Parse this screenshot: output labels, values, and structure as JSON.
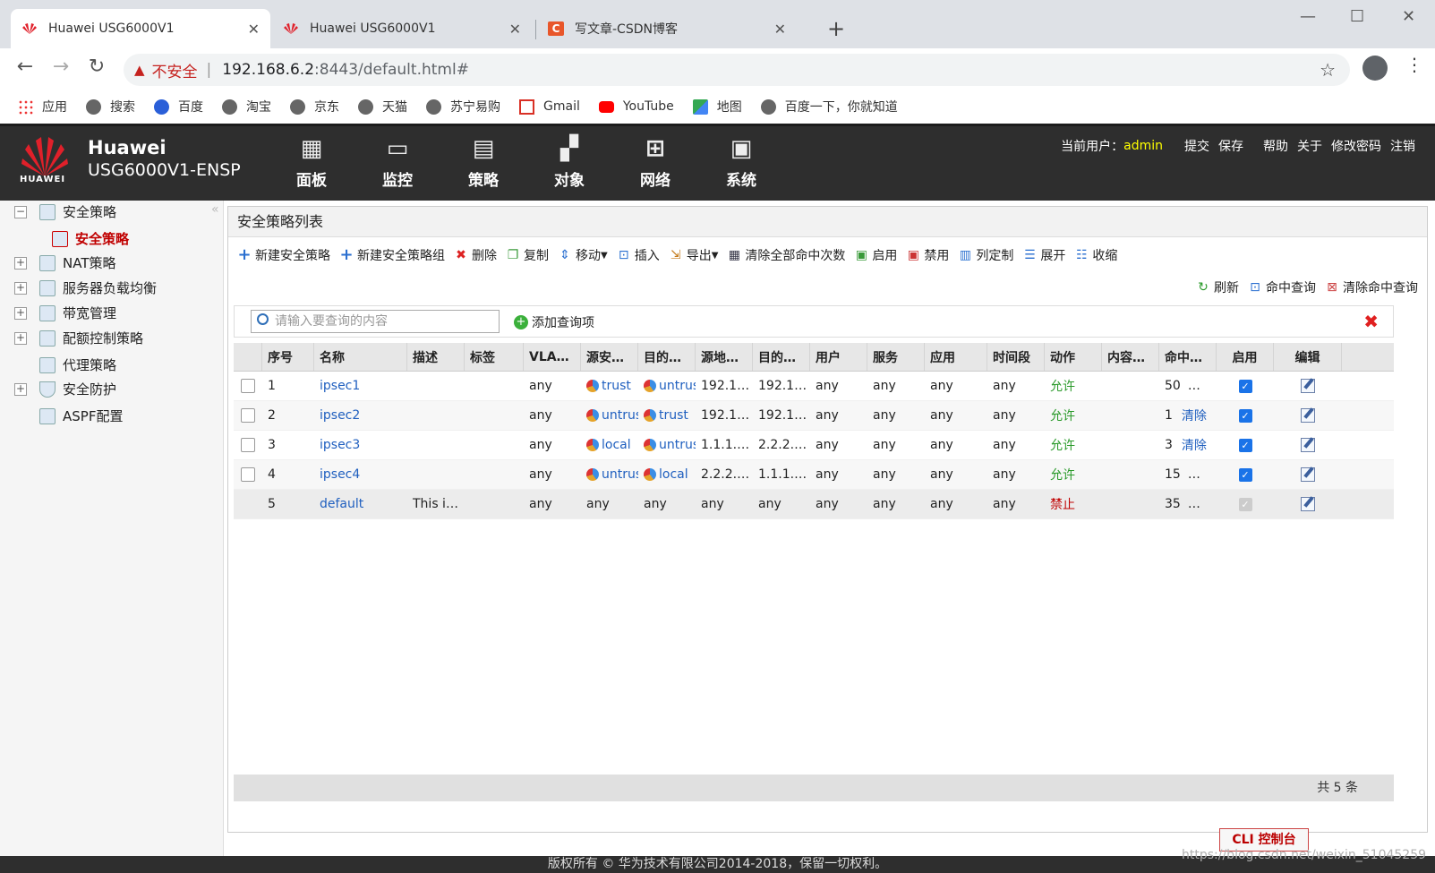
{
  "browser": {
    "tabs": [
      {
        "title": "Huawei USG6000V1",
        "active": true
      },
      {
        "title": "Huawei USG6000V1",
        "active": false
      },
      {
        "title": "写文章-CSDN博客",
        "active": false
      }
    ],
    "omnibox": {
      "security_label": "不安全",
      "host": "192.168.6.2",
      "path": ":8443/default.html#"
    },
    "bookmarks": [
      "应用",
      "搜索",
      "百度",
      "淘宝",
      "京东",
      "天猫",
      "苏宁易购",
      "Gmail",
      "YouTube",
      "地图",
      "百度一下，你就知道"
    ]
  },
  "app": {
    "brand_line1": "Huawei",
    "brand_line2": "USG6000V1-ENSP",
    "logo_text": "HUAWEI",
    "main_nav": [
      "面板",
      "监控",
      "策略",
      "对象",
      "网络",
      "系统"
    ],
    "user_label": "当前用户：",
    "user_name": "admin",
    "user_links": [
      "提交",
      "保存",
      "帮助",
      "关于",
      "修改密码",
      "注销"
    ]
  },
  "sidebar": {
    "items": [
      {
        "label": "安全策略",
        "expander": "−"
      },
      {
        "label": "安全策略",
        "selected": true
      },
      {
        "label": "NAT策略",
        "expander": "+"
      },
      {
        "label": "服务器负载均衡",
        "expander": "+"
      },
      {
        "label": "带宽管理",
        "expander": "+"
      },
      {
        "label": "配额控制策略",
        "expander": "+"
      },
      {
        "label": "代理策略",
        "expander": ""
      },
      {
        "label": "安全防护",
        "expander": "+"
      },
      {
        "label": "ASPF配置",
        "expander": ""
      }
    ]
  },
  "page": {
    "title": "安全策略列表",
    "toolbar": [
      "新建安全策略",
      "新建安全策略组",
      "删除",
      "复制",
      "移动",
      "插入",
      "导出",
      "清除全部命中次数",
      "启用",
      "禁用",
      "列定制",
      "展开",
      "收缩"
    ],
    "toolbar2": [
      "刷新",
      "命中查询",
      "清除命中查询"
    ],
    "search_placeholder": "请输入要查询的内容",
    "add_query": "添加查询项",
    "columns": [
      "序号",
      "名称",
      "描述",
      "标签",
      "VLA…",
      "源安…",
      "目的…",
      "源地…",
      "目的…",
      "用户",
      "服务",
      "应用",
      "时间段",
      "动作",
      "内容…",
      "命中…",
      "启用",
      "编辑"
    ],
    "rows": [
      {
        "no": "1",
        "name": "ipsec1",
        "desc": "",
        "tag": "",
        "vlan": "any",
        "src_zone": "trust",
        "dst_zone": "untrust",
        "src_addr": "192.1…",
        "dst_addr": "192.1…",
        "user": "any",
        "service": "any",
        "app": "any",
        "time": "any",
        "action": "允许",
        "content": "",
        "hits": "50",
        "hits_extra": "…",
        "enabled": true
      },
      {
        "no": "2",
        "name": "ipsec2",
        "desc": "",
        "tag": "",
        "vlan": "any",
        "src_zone": "untrust",
        "dst_zone": "trust",
        "src_addr": "192.1…",
        "dst_addr": "192.1…",
        "user": "any",
        "service": "any",
        "app": "any",
        "time": "any",
        "action": "允许",
        "content": "",
        "hits": "1",
        "hits_extra": "清除",
        "enabled": true
      },
      {
        "no": "3",
        "name": "ipsec3",
        "desc": "",
        "tag": "",
        "vlan": "any",
        "src_zone": "local",
        "dst_zone": "untrust",
        "src_addr": "1.1.1.…",
        "dst_addr": "2.2.2.…",
        "user": "any",
        "service": "any",
        "app": "any",
        "time": "any",
        "action": "允许",
        "content": "",
        "hits": "3",
        "hits_extra": "清除",
        "enabled": true
      },
      {
        "no": "4",
        "name": "ipsec4",
        "desc": "",
        "tag": "",
        "vlan": "any",
        "src_zone": "untrust",
        "dst_zone": "local",
        "src_addr": "2.2.2.…",
        "dst_addr": "1.1.1.…",
        "user": "any",
        "service": "any",
        "app": "any",
        "time": "any",
        "action": "允许",
        "content": "",
        "hits": "15",
        "hits_extra": "…",
        "enabled": true
      },
      {
        "no": "5",
        "name": "default",
        "desc": "This i…",
        "tag": "",
        "vlan": "any",
        "src_zone": "any",
        "dst_zone": "any",
        "src_addr": "any",
        "dst_addr": "any",
        "user": "any",
        "service": "any",
        "app": "any",
        "time": "any",
        "action": "禁止",
        "content": "",
        "hits": "35",
        "hits_extra": "…",
        "enabled": true
      }
    ],
    "total": "共 5 条",
    "cli_button": "CLI 控制台",
    "copyright": "版权所有 © 华为技术有限公司2014-2018，保留一切权利。",
    "watermark": "https://blog.csdn.net/weixin_51045259"
  }
}
